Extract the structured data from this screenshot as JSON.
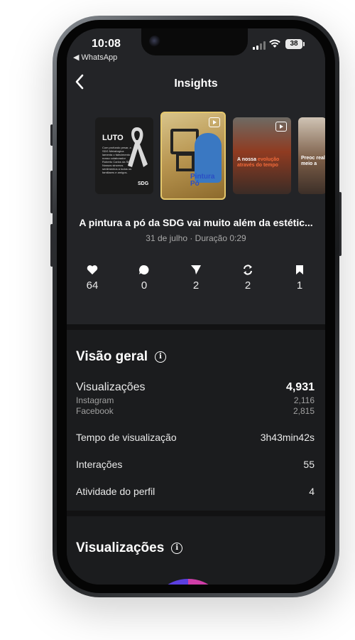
{
  "status_bar": {
    "time": "10:08",
    "back_app": "◀ WhatsApp",
    "battery": "38"
  },
  "nav": {
    "back_icon": "chevron-left-icon",
    "title": "Insights"
  },
  "thumbnails": [
    {
      "title": "LUTO",
      "body": "Com profundo pesar, a SDG Metalúrgica lamenta o falecimento do nosso colaborador Roberto Carlos da Silva. Nossos sinceros sentimentos a todos os familiares e amigos.",
      "logo": "SDG"
    },
    {
      "caption": "Pintura Pó"
    },
    {
      "caption_start": "A nossa ",
      "caption_highlight": "evolução através do tempo"
    },
    {
      "caption": "Preoc real co meio a"
    }
  ],
  "post": {
    "title": "A pintura a pó da SDG vai muito além da estétic...",
    "meta": "31 de julho · Duração 0:29"
  },
  "stats": [
    {
      "icon": "heart-icon",
      "value": "64"
    },
    {
      "icon": "comment-icon",
      "value": "0"
    },
    {
      "icon": "send-icon",
      "value": "2"
    },
    {
      "icon": "repost-icon",
      "value": "2"
    },
    {
      "icon": "bookmark-icon",
      "value": "1"
    }
  ],
  "overview": {
    "title": "Visão geral",
    "views_label": "Visualizações",
    "views_value": "4,931",
    "instagram_label": "Instagram",
    "instagram_value": "2,116",
    "facebook_label": "Facebook",
    "facebook_value": "2,815",
    "watch_time_label": "Tempo de visualização",
    "watch_time_value": "3h43min42s",
    "interactions_label": "Interações",
    "interactions_value": "55",
    "profile_activity_label": "Atividade do perfil",
    "profile_activity_value": "4"
  },
  "views_section": {
    "title": "Visualizações"
  },
  "colors": {
    "background": "#1b1c1e",
    "header": "#232427",
    "donut_purple": "#7f2ee6",
    "donut_pink": "#cf3ea8"
  }
}
